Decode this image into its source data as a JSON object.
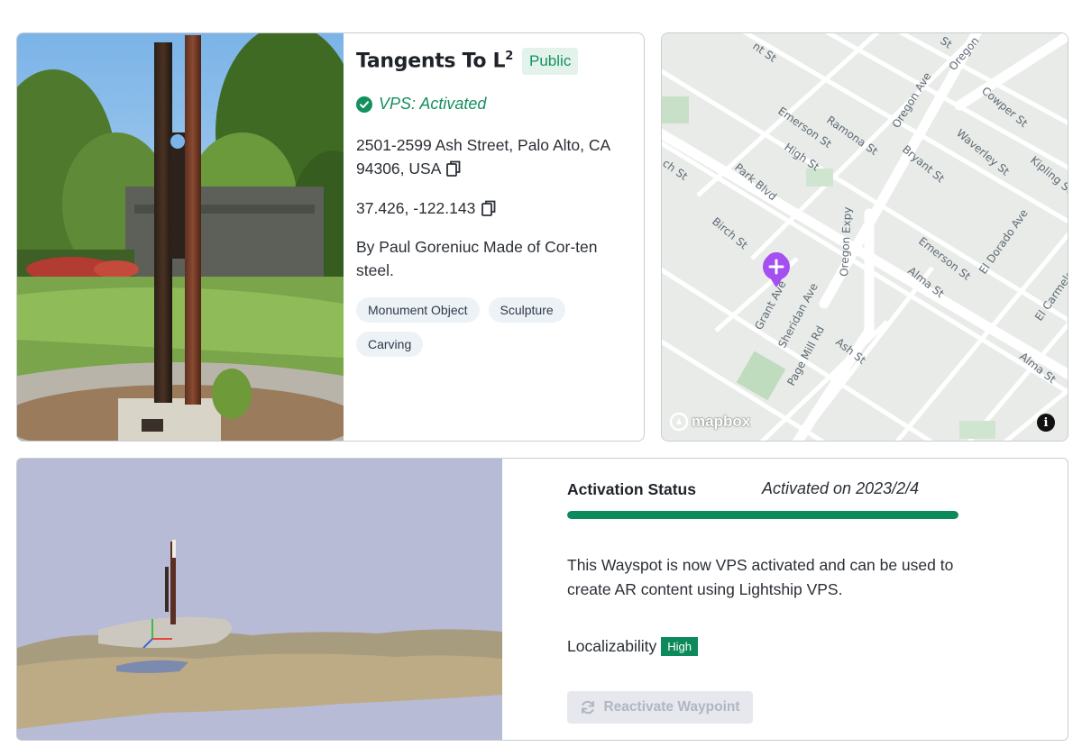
{
  "wayspot": {
    "title": "Tangents To L",
    "title_sup": "2",
    "visibility": "Public",
    "vps_status": "VPS: Activated",
    "address": "2501-2599 Ash Street, Palo Alto, CA 94306, USA",
    "coordinates": "37.426, -122.143",
    "description": "By Paul Goreniuc Made of Cor-ten steel.",
    "tags": [
      "Monument Object",
      "Sculpture",
      "Carving"
    ]
  },
  "map": {
    "street_labels": [
      "Emerson St",
      "Ramona St",
      "High St",
      "Park Blvd",
      "Birch St",
      "Oregon Expy",
      "Oregon Ave",
      "Bryant St",
      "Waverley St",
      "Cowper St",
      "Kipling St",
      "Emerson St",
      "El Dorado Ave",
      "Alma St",
      "Alma St",
      "Grant Ave",
      "Sheridan Ave",
      "Page Mill Rd",
      "Ash St",
      "El Carmelo",
      "nt St",
      "ch St",
      "St",
      "Oregon"
    ],
    "attribution": "mapbox",
    "pin_color": "#a64ff0"
  },
  "activation": {
    "label": "Activation Status",
    "activated_on": "Activated on 2023/2/4",
    "progress": 1.0,
    "description": "This Wayspot is now VPS activated and can be used to create AR content using Lightship VPS.",
    "localizability_label": "Localizability",
    "localizability_value": "High",
    "reactivate_label": "Reactivate Waypoint"
  },
  "colors": {
    "accent_green": "#13905e",
    "badge_green_bg": "#e3f3ec",
    "tag_bg": "#edf2f7",
    "scan_bg": "#b7bbd6"
  }
}
